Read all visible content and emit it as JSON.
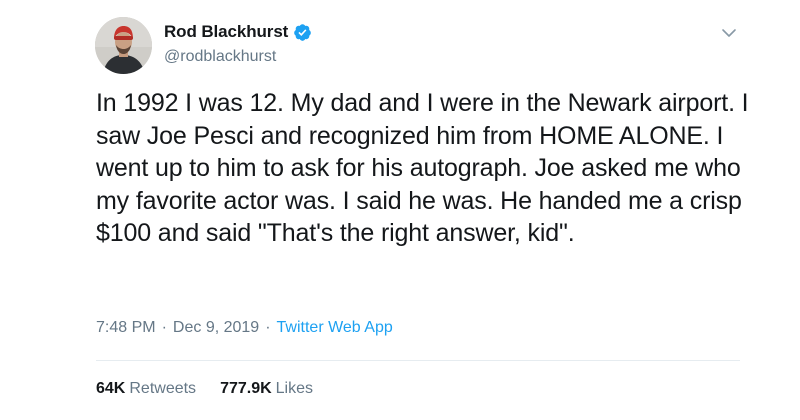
{
  "tweet": {
    "author": {
      "display_name": "Rod Blackhurst",
      "handle": "@rodblackhurst",
      "verified": true
    },
    "text": "In 1992 I was 12. My dad and I were in the Newark airport. I saw Joe Pesci and recognized him from HOME ALONE. I went up to him to ask for his autograph. Joe asked me who my favorite actor was. I said he was. He handed me a crisp $100 and said \"That's the right answer, kid\".",
    "time": "7:48 PM",
    "separator": "·",
    "date": "Dec 9, 2019",
    "source": "Twitter Web App",
    "retweets": {
      "count": "64K",
      "label": "Retweets"
    },
    "likes": {
      "count": "777.9K",
      "label": "Likes"
    }
  },
  "colors": {
    "text": "#14171a",
    "secondary": "#657786",
    "accent": "#1da1f2",
    "divider": "#e6ecf0"
  },
  "icons": {
    "verified": "verified-badge-icon",
    "more": "chevron-down-icon"
  }
}
